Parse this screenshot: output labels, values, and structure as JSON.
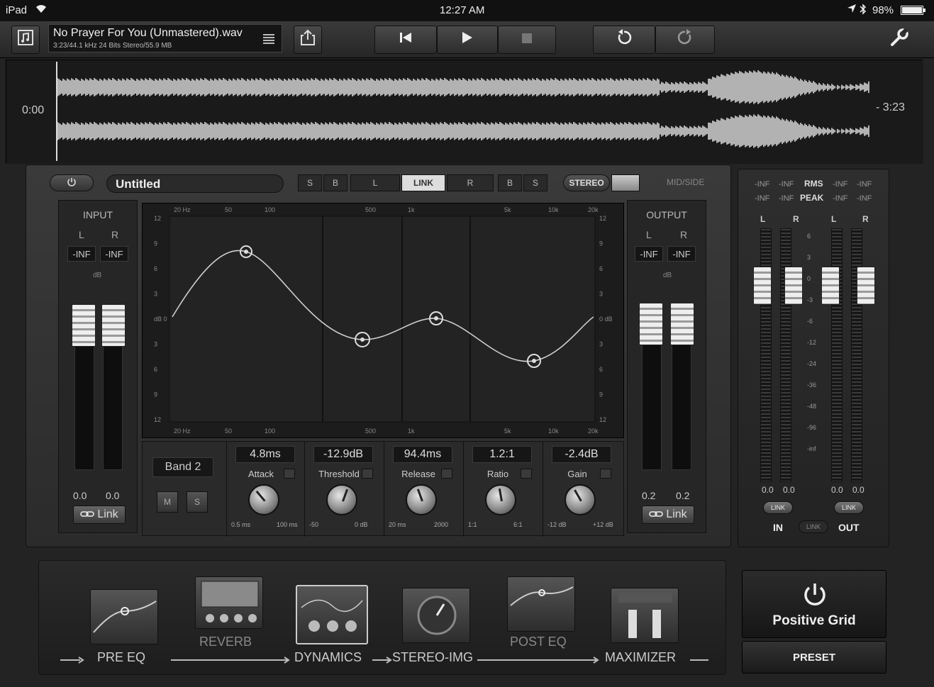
{
  "status_bar": {
    "device": "iPad",
    "time": "12:27 AM",
    "battery": "98%"
  },
  "toolbar": {
    "file_name": "No Prayer For You (Unmastered).wav",
    "file_info": "3:23/44.1 kHz 24 Bits Stereo/55.9 MB"
  },
  "waveform": {
    "start_time": "0:00",
    "end_time": "- 3:23",
    "playhead_progress": 0.0
  },
  "header": {
    "preset_name": "Untitled",
    "band_buttons": [
      "S",
      "B",
      "L",
      "LINK",
      "R",
      "B",
      "S"
    ],
    "mode_stereo": "STEREO",
    "mode_midside": "MID/SIDE"
  },
  "input": {
    "title": "INPUT",
    "l": "L",
    "r": "R",
    "peak_l": "-INF",
    "peak_r": "-INF",
    "val_l": "0.0",
    "val_r": "0.0",
    "db": "dB",
    "link": "Link"
  },
  "output": {
    "title": "OUTPUT",
    "l": "L",
    "r": "R",
    "peak_l": "-INF",
    "peak_r": "-INF",
    "val_l": "0.2",
    "val_r": "0.2",
    "db": "dB",
    "link": "Link"
  },
  "eq": {
    "freq_labels": [
      "20 Hz",
      "50",
      "100",
      "500",
      "1k",
      "5k",
      "10k",
      "20k"
    ],
    "db_labels_left": [
      "12",
      "9",
      "6",
      "3",
      "dB 0",
      "3",
      "6",
      "9",
      "12"
    ],
    "db_labels_right": [
      "12",
      "9",
      "6",
      "3",
      "0 dB",
      "3",
      "6",
      "9",
      "12"
    ]
  },
  "dynamics": {
    "band": "Band 2",
    "m": "M",
    "s": "S",
    "controls": [
      {
        "value": "4.8ms",
        "name": "Attack",
        "min": "0.5 ms",
        "max": "100 ms"
      },
      {
        "value": "-12.9dB",
        "name": "Threshold",
        "min": "-50",
        "max": "0 dB"
      },
      {
        "value": "94.4ms",
        "name": "Release",
        "min": "20 ms",
        "max": "2000"
      },
      {
        "value": "1.2:1",
        "name": "Ratio",
        "min": "1:1",
        "max": "6:1"
      },
      {
        "value": "-2.4dB",
        "name": "Gain",
        "min": "-12 dB",
        "max": "+12 dB"
      }
    ]
  },
  "side_meters": {
    "rms": "RMS",
    "peak": "PEAK",
    "inf_top": [
      "-INF",
      "-INF",
      "-INF",
      "-INF"
    ],
    "inf_bottom": [
      "-INF",
      "-INF",
      "-INF",
      "-INF"
    ],
    "l": "L",
    "r": "R",
    "in_vals": [
      "0.0",
      "0.0"
    ],
    "out_vals": [
      "0.0",
      "0.0"
    ],
    "scale": [
      "6",
      "3",
      "0",
      "-3",
      "-6",
      "-12",
      "-24",
      "-36",
      "-48",
      "-96",
      "-inf"
    ],
    "link": "LINK",
    "in": "IN",
    "out": "OUT"
  },
  "chain": {
    "modules": [
      "PRE EQ",
      "REVERB",
      "DYNAMICS",
      "STEREO-IMG",
      "POST EQ",
      "MAXIMIZER"
    ]
  },
  "brand": {
    "name": "Positive Grid",
    "preset": "PRESET"
  }
}
